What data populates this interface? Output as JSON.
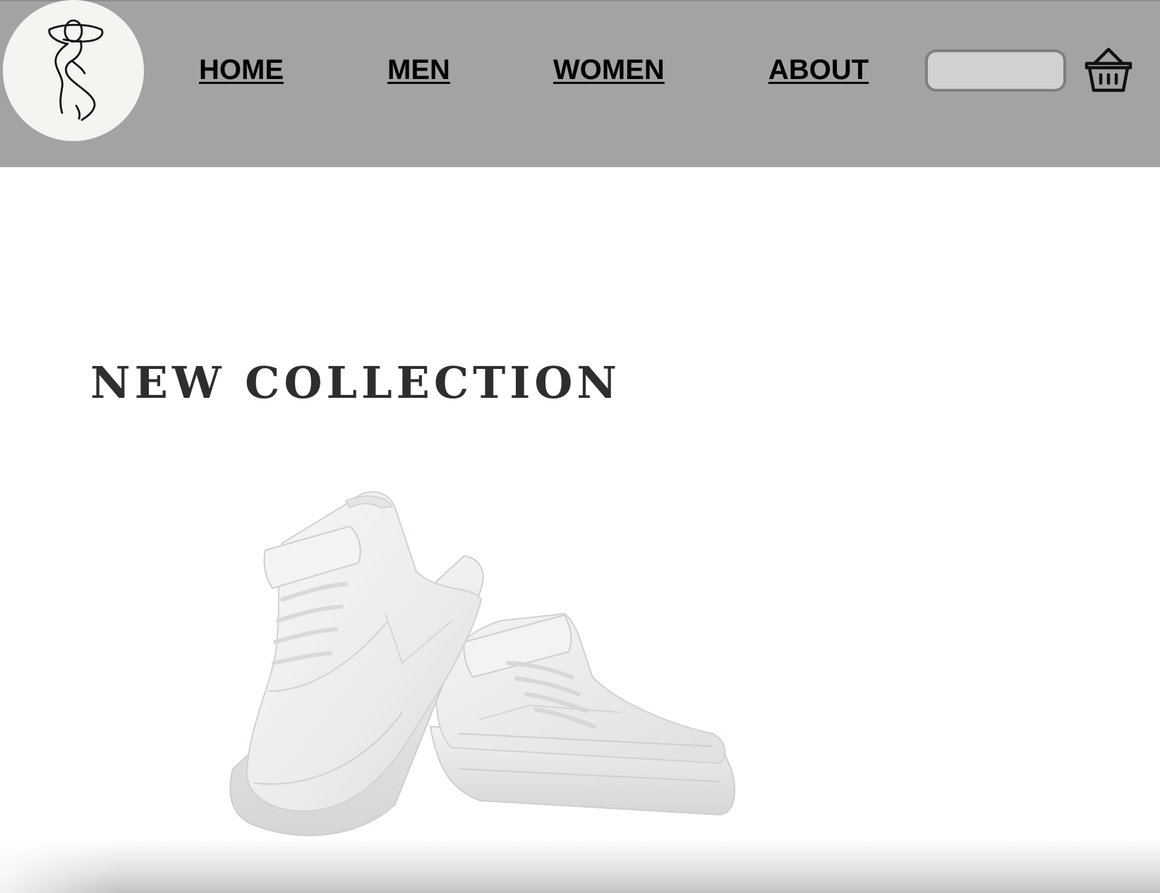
{
  "header": {
    "background_color": "#a3a3a3",
    "logo_icon": "line-art-figure-logo",
    "nav": [
      {
        "label": "HOME"
      },
      {
        "label": "MEN"
      },
      {
        "label": "WOMEN"
      },
      {
        "label": "ABOUT"
      }
    ],
    "search": {
      "value": "",
      "placeholder": ""
    },
    "cart_icon": "basket-icon"
  },
  "main": {
    "headline": "NEW COLLECTION",
    "hero_image": "white-high-top-sneakers-pair"
  }
}
